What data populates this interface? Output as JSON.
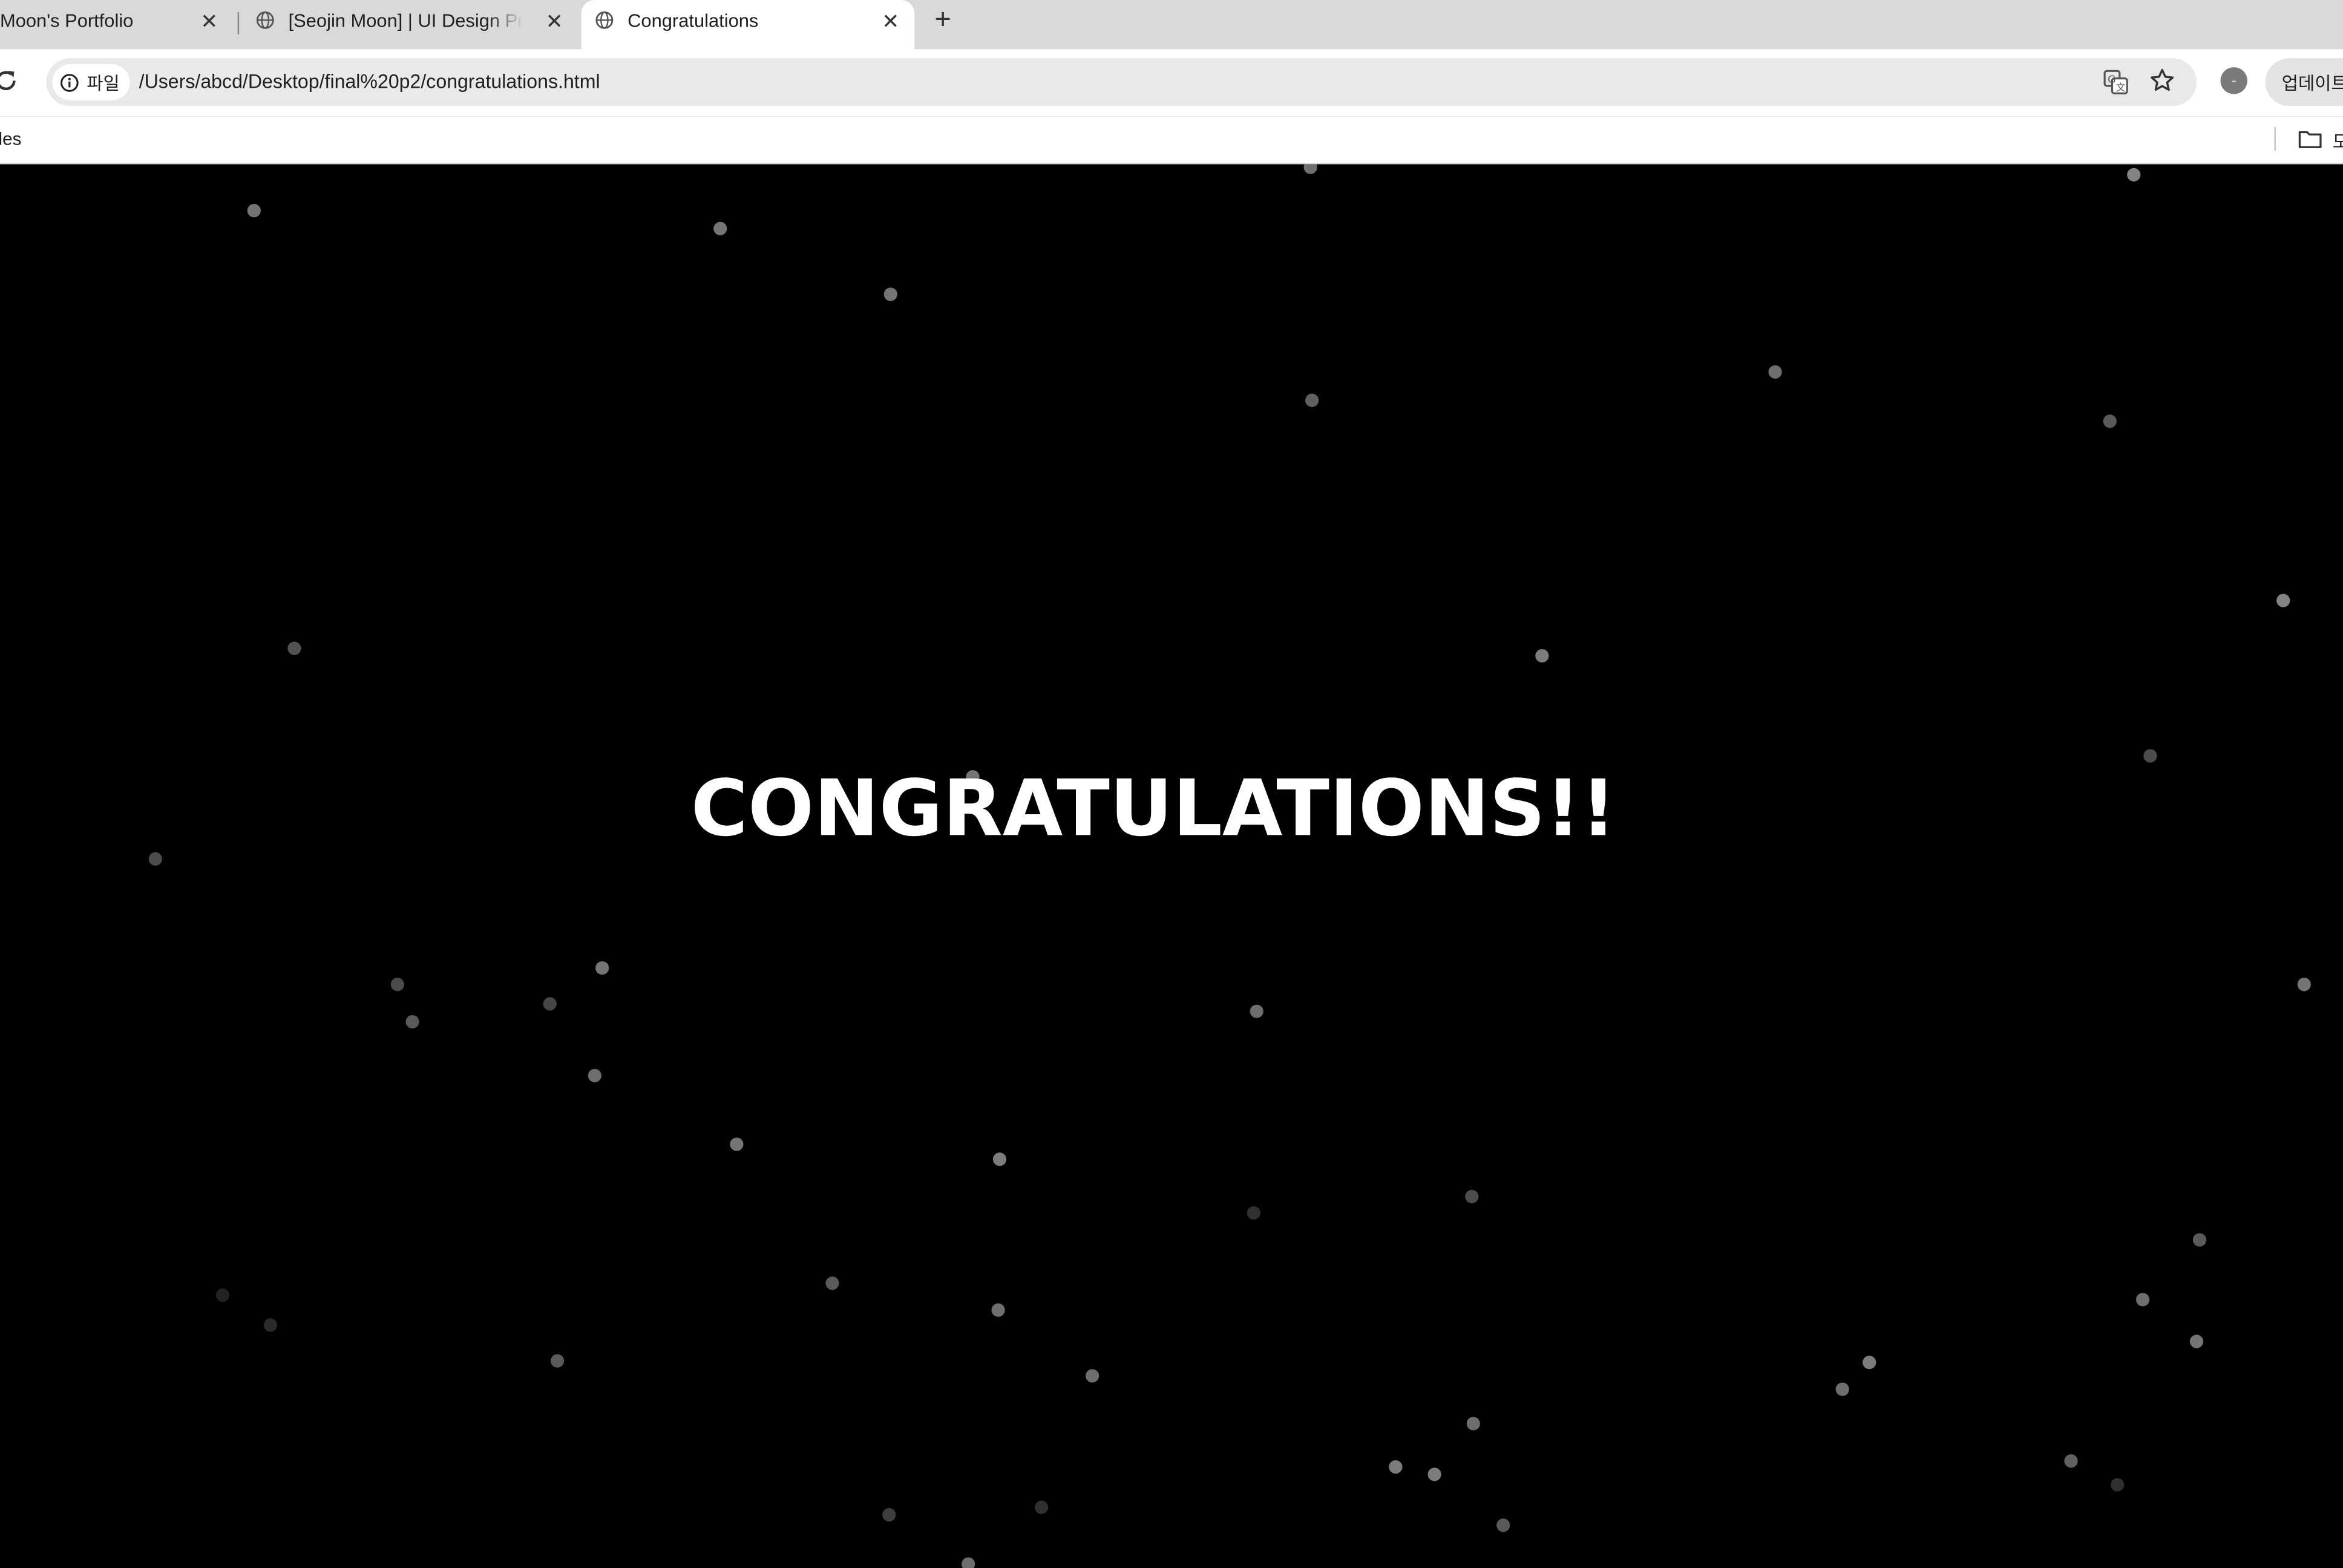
{
  "tabs": [
    {
      "label": "Moon's Portfolio",
      "icon": "none",
      "active": false
    },
    {
      "label": "[Seojin Moon] | UI Design Pro",
      "icon": "globe-icon",
      "active": false
    },
    {
      "label": "Congratulations",
      "icon": "globe-icon",
      "active": true
    }
  ],
  "toolbar": {
    "site_chip_label": "파일",
    "url": "/Users/abcd/Desktop/final%20p2/congratulations.html",
    "update_label": "업데이트",
    "profile_initial": "-"
  },
  "bookmarks": {
    "left_item": "yles",
    "folder_label": "모"
  },
  "page": {
    "headline": "CONGRATULATIONS!!",
    "background": "#000000",
    "headline_color": "#ffffff",
    "dot_color": "#8a8a8a"
  }
}
